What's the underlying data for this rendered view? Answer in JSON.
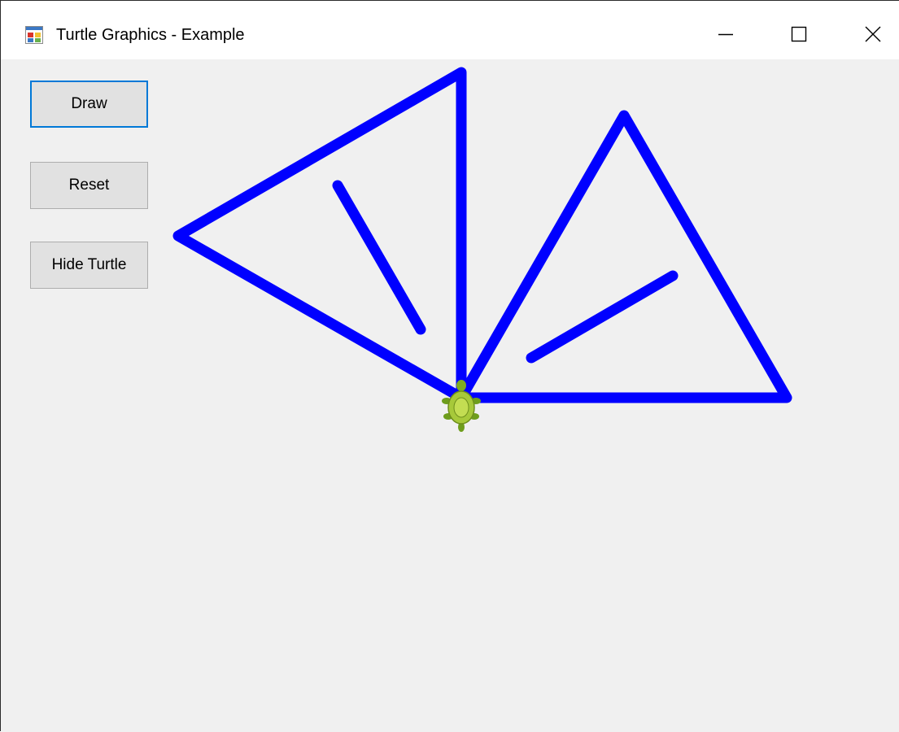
{
  "window": {
    "title": "Turtle Graphics - Example",
    "icon": "app-form-icon",
    "controls": {
      "minimize_icon": "minimize-icon",
      "maximize_icon": "maximize-icon",
      "close_icon": "close-icon"
    }
  },
  "toolbar": {
    "draw_label": "Draw",
    "reset_label": "Reset",
    "hide_turtle_label": "Hide Turtle",
    "focused": "Draw"
  },
  "drawing": {
    "pen_color": "#0000ff",
    "background_color": "#f0f0f0",
    "turtle_icon": "turtle-icon",
    "turtle_visible": true
  },
  "colors": {
    "focus_border": "#0078d7",
    "button_face": "#e1e1e1",
    "button_border": "#adadad"
  }
}
